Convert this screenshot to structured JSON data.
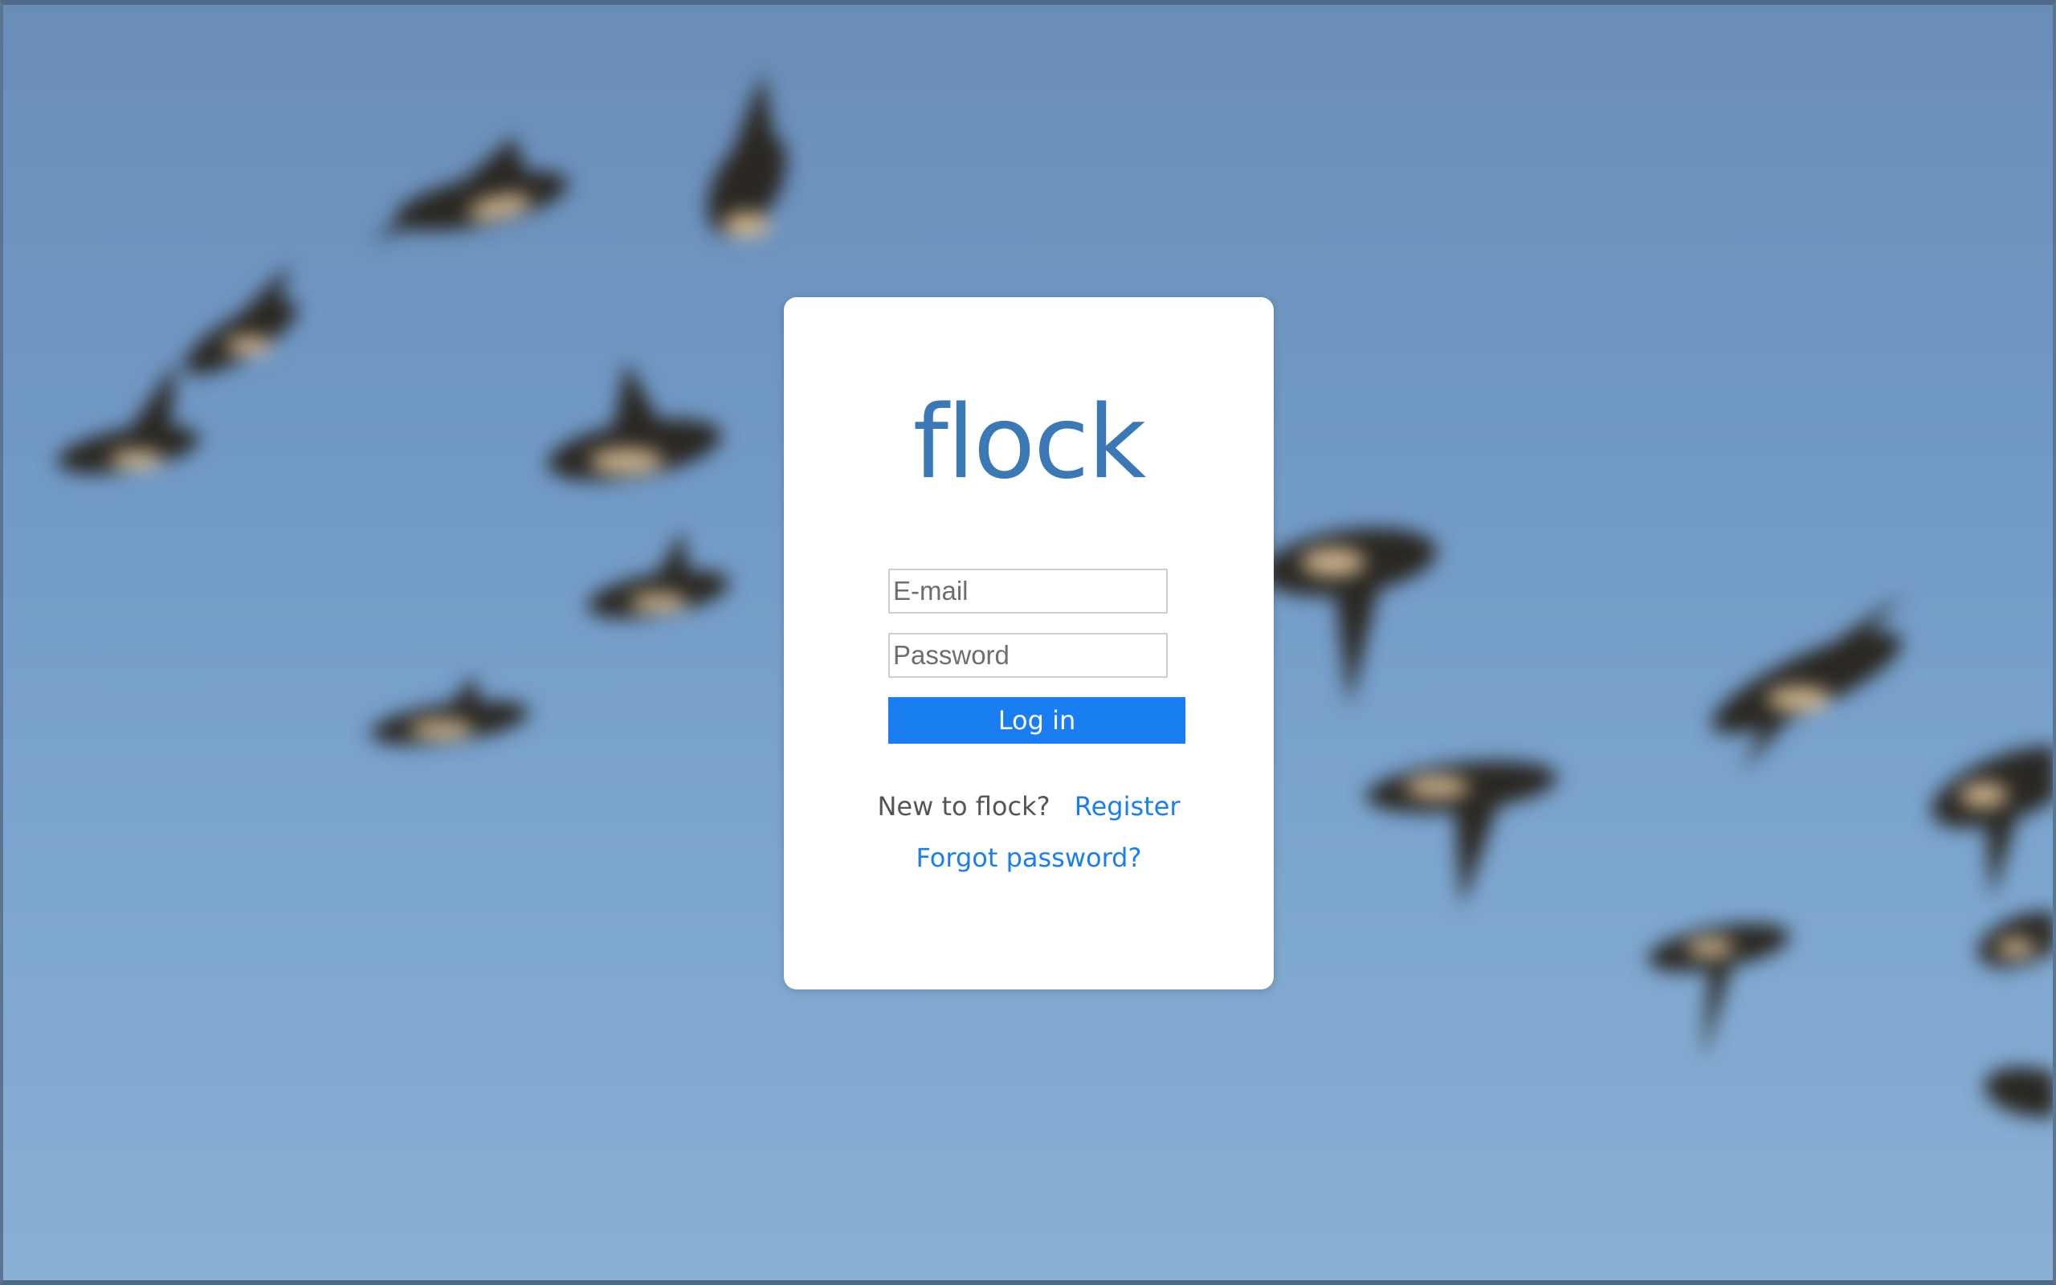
{
  "app": {
    "logo_text": "flock"
  },
  "login_form": {
    "email_placeholder": "E-mail",
    "password_placeholder": "Password",
    "login_label": "Log in"
  },
  "footer_links": {
    "new_user_text": "New to flock?",
    "register_label": "Register",
    "forgot_password_label": "Forgot password?"
  },
  "colors": {
    "brand": "#3a78b6",
    "accent": "#1a7ef3",
    "sky_background": "#7199c6"
  },
  "background": {
    "subject": "flying-geese-photo"
  }
}
